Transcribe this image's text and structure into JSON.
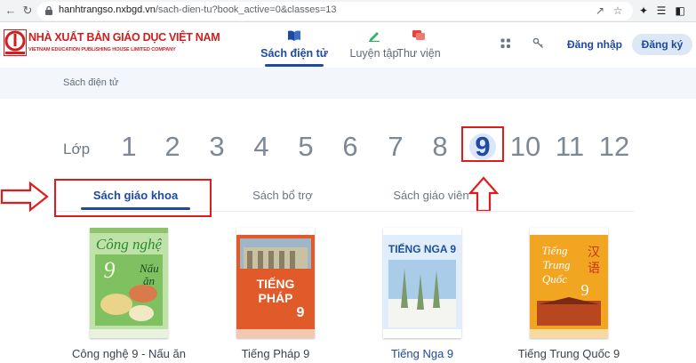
{
  "browser": {
    "url_host": "hanhtrangso.nxbgd.vn",
    "url_path": "/sach-dien-tu?book_active=0&classes=13"
  },
  "header": {
    "logo_title": "NHÀ XUẤT BẢN GIÁO DỤC VIỆT NAM",
    "logo_subtitle": "VIETNAM EDUCATION PUBLISHING HOUSE LIMITED COMPANY",
    "nav": [
      {
        "label": "Sách điện tử",
        "icon": "book-open-icon",
        "active": true
      },
      {
        "label": "Luyện tập",
        "icon": "pencil-icon",
        "active": false
      },
      {
        "label": "Thư viện",
        "icon": "library-icon",
        "active": false
      }
    ],
    "login_label": "Đăng nhập",
    "register_label": "Đăng ký"
  },
  "breadcrumb": "Sách điện tử",
  "grade": {
    "label": "Lớp",
    "numbers": [
      "1",
      "2",
      "3",
      "4",
      "5",
      "6",
      "7",
      "8",
      "9",
      "10",
      "11",
      "12"
    ],
    "selected": "9"
  },
  "tabs": [
    {
      "label": "Sách giáo khoa",
      "active": true
    },
    {
      "label": "Sách bổ trợ",
      "active": false
    },
    {
      "label": "Sách giáo viên",
      "active": false
    }
  ],
  "books": [
    {
      "title": "Công nghệ 9 - Nấu ăn",
      "cover_text": [
        "Công nghệ",
        "9",
        "Nấu",
        "ăn"
      ]
    },
    {
      "title": "Tiếng Pháp 9",
      "cover_text": [
        "TIẾNG",
        "PHÁP",
        "9"
      ]
    },
    {
      "title": "Tiếng Nga 9",
      "cover_text": [
        "TIẾNG NGA 9"
      ]
    },
    {
      "title": "Tiếng Trung Quốc 9",
      "cover_text": [
        "Tiếng",
        "Trung",
        "Quốc",
        "9",
        "汉",
        "语"
      ]
    }
  ],
  "colors": {
    "brand_blue": "#1f4aa0",
    "brand_red": "#d21e1e",
    "annotation_red": "#e01b1b"
  }
}
